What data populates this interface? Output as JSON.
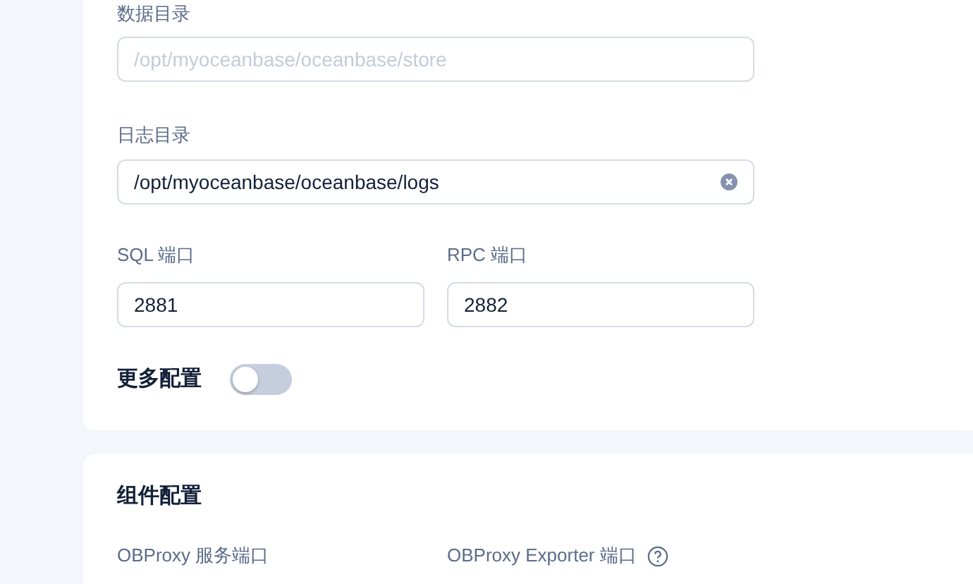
{
  "cluster_section": {
    "fields": [
      {
        "label": "数据目录",
        "placeholder": "/opt/myoceanbase/oceanbase/store",
        "clearable": false
      },
      {
        "label": "日志目录",
        "value": "/opt/myoceanbase/oceanbase/logs",
        "clearable": true
      }
    ],
    "port_fields": [
      {
        "label": "SQL 端口",
        "value": "2881"
      },
      {
        "label": "RPC 端口",
        "value": "2882"
      }
    ],
    "more_config": {
      "label": "更多配置",
      "on": false
    }
  },
  "component_section": {
    "title": "组件配置",
    "port_labels": [
      {
        "label": "OBProxy 服务端口",
        "help": false
      },
      {
        "label": "OBProxy Exporter 端口",
        "help": true
      }
    ]
  }
}
